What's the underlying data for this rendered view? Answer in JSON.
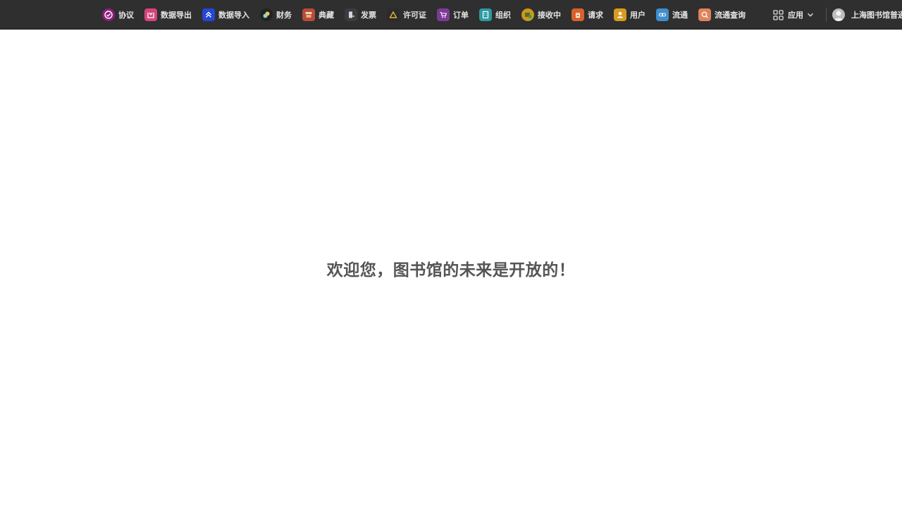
{
  "nav": {
    "items": [
      {
        "label": "协议",
        "icon": "agreement-check-icon",
        "color": "#8e1e78"
      },
      {
        "label": "数据导出",
        "icon": "data-export-icon",
        "color": "#d6457a"
      },
      {
        "label": "数据导入",
        "icon": "data-import-icon",
        "color": "#2446d8"
      },
      {
        "label": "财务",
        "icon": "finance-coins-icon",
        "color": "#222222"
      },
      {
        "label": "典藏",
        "icon": "collection-icon",
        "color": "#b84a3c"
      },
      {
        "label": "发票",
        "icon": "invoice-door-icon",
        "color": "#3c3c3c"
      },
      {
        "label": "许可证",
        "icon": "license-triangle-icon",
        "color": "#2b2b2b"
      },
      {
        "label": "订单",
        "icon": "order-cart-icon",
        "color": "#7c3a96"
      },
      {
        "label": "组织",
        "icon": "organization-building-icon",
        "color": "#2a9aa2"
      },
      {
        "label": "接收中",
        "icon": "receiving-box-icon",
        "color": "#c99a1c"
      },
      {
        "label": "请求",
        "icon": "request-icon",
        "color": "#d8612a"
      },
      {
        "label": "用户",
        "icon": "user-icon",
        "color": "#d99a1f"
      },
      {
        "label": "流通",
        "icon": "circulation-icon",
        "color": "#3f8fcf"
      },
      {
        "label": "流通查询",
        "icon": "circulation-search-icon",
        "color": "#e0835a"
      }
    ]
  },
  "apps": {
    "label": "应用",
    "icon": "apps-grid-icon"
  },
  "user": {
    "name": "上海图书馆普通",
    "icon": "avatar-icon"
  },
  "main": {
    "welcome": "欢迎您，图书馆的未来是开放的！"
  }
}
